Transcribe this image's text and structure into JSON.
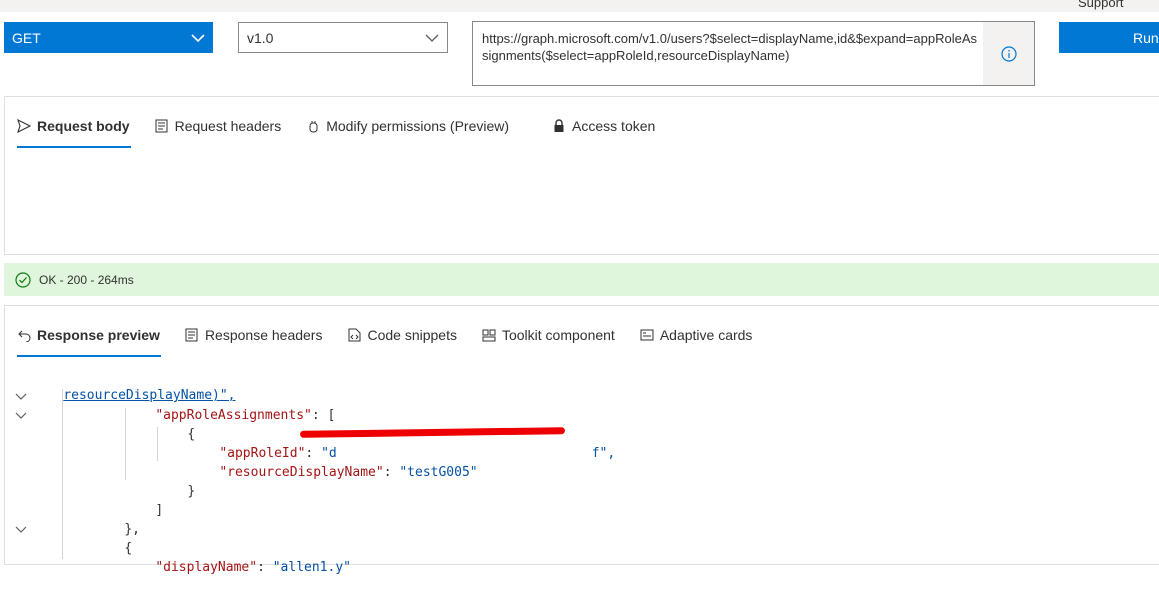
{
  "header": {
    "support_label": "Support",
    "method": "GET",
    "version": "v1.0",
    "url": "https://graph.microsoft.com/v1.0/users?$select=displayName,id&$expand=appRoleAssignments($select=appRoleId,resourceDisplayName)",
    "run_label": "Run"
  },
  "request_tabs": [
    {
      "label": "Request body",
      "icon": "send-icon"
    },
    {
      "label": "Request headers",
      "icon": "document-icon"
    },
    {
      "label": "Modify permissions (Preview)",
      "icon": "permissions-icon"
    },
    {
      "label": "Access token",
      "icon": "lock-icon"
    }
  ],
  "status": {
    "text": "OK - 200 - 264ms",
    "color": "#dff6dd"
  },
  "response_tabs": [
    {
      "label": "Response preview",
      "icon": "undo-arrow-icon"
    },
    {
      "label": "Response headers",
      "icon": "document-icon"
    },
    {
      "label": "Code snippets",
      "icon": "code-file-icon"
    },
    {
      "label": "Toolkit component",
      "icon": "toolkit-icon"
    },
    {
      "label": "Adaptive cards",
      "icon": "card-icon"
    }
  ],
  "response_code": {
    "l1": "resourceDisplayName)\",",
    "l2_key": "\"appRoleAssignments\"",
    "l2_rest": ": [",
    "l3": "{",
    "l4_key": "\"appRoleId\"",
    "l4_val_start": "\"d",
    "l4_val_end": "f\",",
    "l5_key": "\"resourceDisplayName\"",
    "l5_val": "\"testG005\"",
    "l6": "}",
    "l7": "]",
    "l8": "},",
    "l9": "{",
    "l10_key": "\"displayName\"",
    "l10_val": "\"allen1.y\""
  }
}
